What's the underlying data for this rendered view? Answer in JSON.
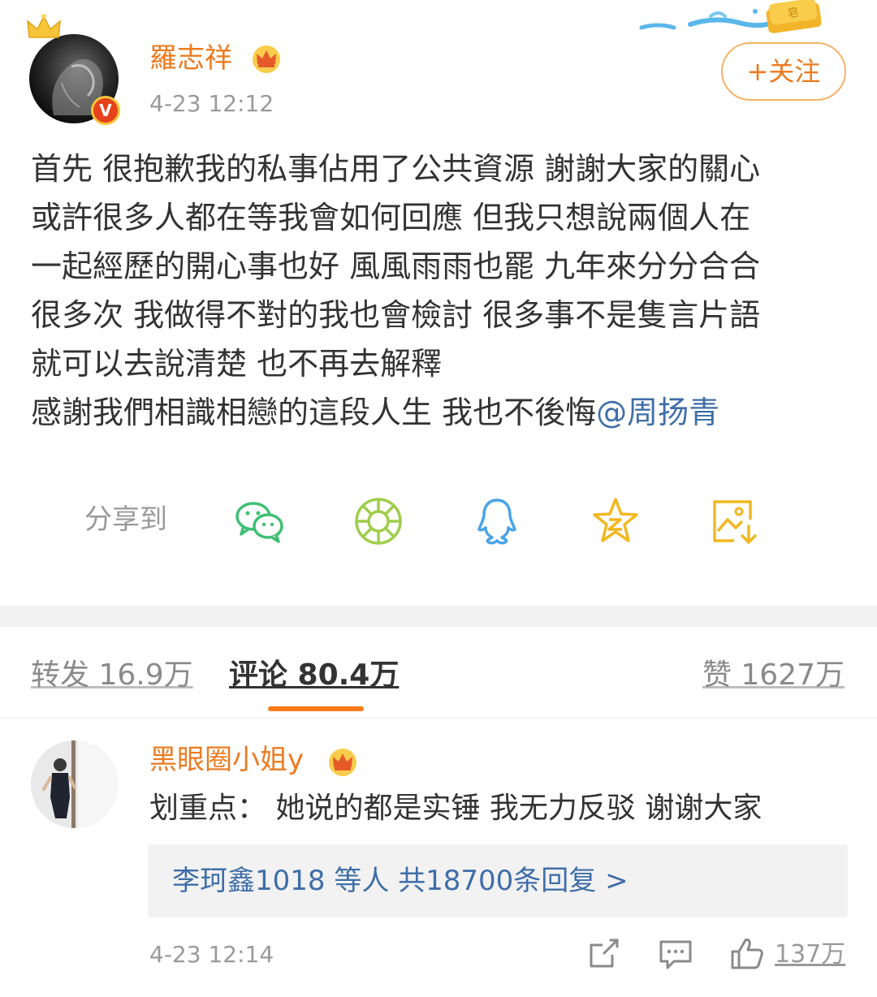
{
  "post": {
    "author": "羅志祥",
    "time": "4-23 12:12",
    "follow_label": "+关注",
    "verified_badge": "V",
    "body_lines": [
      "首先 很抱歉我的私事佔用了公共資源 謝謝大家的關心",
      "或許很多人都在等我會如何回應 但我只想說兩個人在",
      "一起經歷的開心事也好 風風雨雨也罷 九年來分分合合",
      "很多次 我做得不對的我也會檢討 很多事不是隻言片語",
      "就可以去說清楚 也不再去解釋"
    ],
    "last_line_text": "感謝我們相識相戀的這段人生 我也不後悔",
    "mention": "@周扬青"
  },
  "share": {
    "label": "分享到",
    "icons": [
      "wechat-icon",
      "moments-icon",
      "qq-icon",
      "qzone-icon",
      "save-image-icon"
    ]
  },
  "tabs": {
    "repost": "转发 16.9万",
    "comment": "评论 80.4万",
    "like": "赞 1627万"
  },
  "comment": {
    "user": "黑眼圈小姐y",
    "text": "划重点：  她说的都是实锤 我无力反驳 谢谢大家",
    "reply_summary": "李珂鑫1018 等人  共18700条回复 >",
    "time": "4-23 12:14",
    "likes": "137万"
  },
  "colors": {
    "accent_orange": "#eb7b20",
    "link_blue": "#3f6ea8",
    "muted_gray": "#9a9a9a"
  }
}
